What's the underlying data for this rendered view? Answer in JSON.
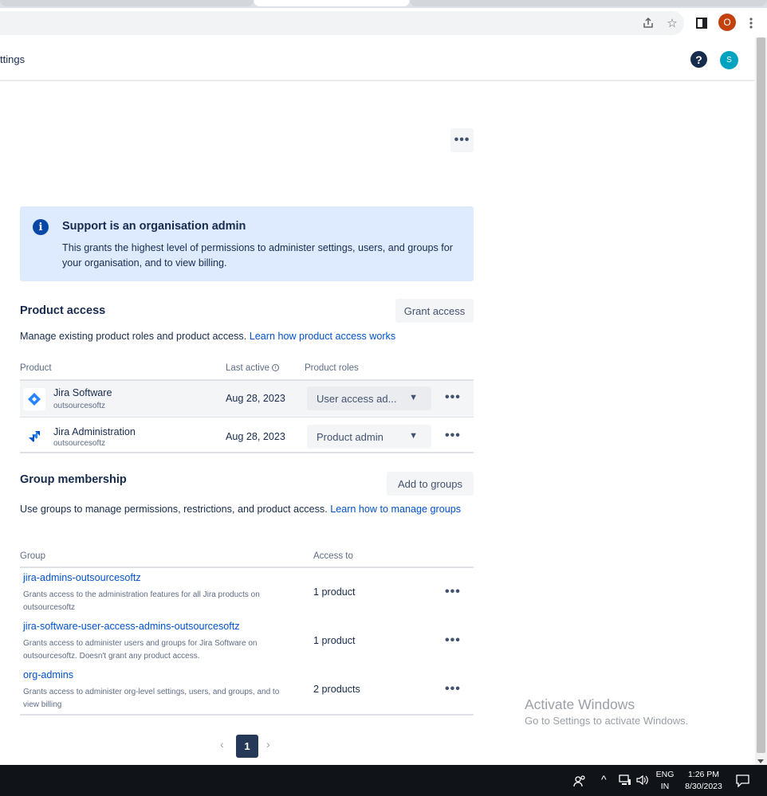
{
  "browser": {
    "profile_initial": "O"
  },
  "header": {
    "title": "ttings",
    "help": "?",
    "avatar_initial": "S"
  },
  "more_menu": "•••",
  "banner": {
    "title": "Support is an organisation admin",
    "text": "This grants the highest level of permissions to administer settings, users, and groups for your organisation, and to view billing."
  },
  "product_access": {
    "title": "Product access",
    "grant_button": "Grant access",
    "description": "Manage existing product roles and product access.",
    "link": "Learn how product access works",
    "columns": {
      "product": "Product",
      "last_active": "Last active",
      "roles": "Product roles"
    },
    "rows": [
      {
        "name": "Jira Software",
        "site": "outsourcesoftz",
        "last_active": "Aug 28, 2023",
        "role": "User access ad..."
      },
      {
        "name": "Jira Administration",
        "site": "outsourcesoftz",
        "last_active": "Aug 28, 2023",
        "role": "Product admin"
      }
    ]
  },
  "group_membership": {
    "title": "Group membership",
    "add_button": "Add to groups",
    "description": "Use groups to manage permissions, restrictions, and product access.",
    "link": "Learn how to manage groups",
    "columns": {
      "group": "Group",
      "access": "Access to"
    },
    "rows": [
      {
        "name": "jira-admins-outsourcesoftz",
        "description": "Grants access to the administration features for all Jira products on outsourcesoftz",
        "access": "1 product"
      },
      {
        "name": "jira-software-user-access-admins-outsourcesoftz",
        "description": "Grants access to administer users and groups for Jira Software on outsourcesoftz. Doesn't grant any product access.",
        "access": "1 product"
      },
      {
        "name": "org-admins",
        "description": "Grants access to administer org-level settings, users, and groups, and to view billing",
        "access": "2 products"
      }
    ]
  },
  "pagination": {
    "current": "1",
    "prev": "‹",
    "next": "›"
  },
  "watermark": {
    "title": "Activate Windows",
    "subtitle": "Go to Settings to activate Windows."
  },
  "taskbar": {
    "lang_line1": "ENG",
    "lang_line2": "IN",
    "time": "1:26 PM",
    "date": "8/30/2023"
  }
}
